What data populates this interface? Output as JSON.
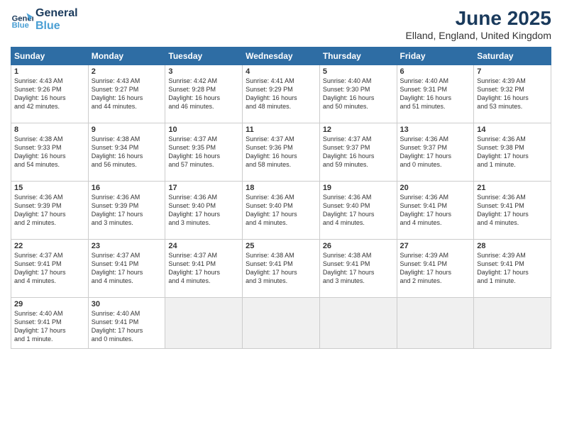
{
  "header": {
    "logo_line1": "General",
    "logo_line2": "Blue",
    "month_year": "June 2025",
    "location": "Elland, England, United Kingdom"
  },
  "days_of_week": [
    "Sunday",
    "Monday",
    "Tuesday",
    "Wednesday",
    "Thursday",
    "Friday",
    "Saturday"
  ],
  "weeks": [
    [
      {
        "day": 1,
        "lines": [
          "Sunrise: 4:43 AM",
          "Sunset: 9:26 PM",
          "Daylight: 16 hours",
          "and 42 minutes."
        ]
      },
      {
        "day": 2,
        "lines": [
          "Sunrise: 4:43 AM",
          "Sunset: 9:27 PM",
          "Daylight: 16 hours",
          "and 44 minutes."
        ]
      },
      {
        "day": 3,
        "lines": [
          "Sunrise: 4:42 AM",
          "Sunset: 9:28 PM",
          "Daylight: 16 hours",
          "and 46 minutes."
        ]
      },
      {
        "day": 4,
        "lines": [
          "Sunrise: 4:41 AM",
          "Sunset: 9:29 PM",
          "Daylight: 16 hours",
          "and 48 minutes."
        ]
      },
      {
        "day": 5,
        "lines": [
          "Sunrise: 4:40 AM",
          "Sunset: 9:30 PM",
          "Daylight: 16 hours",
          "and 50 minutes."
        ]
      },
      {
        "day": 6,
        "lines": [
          "Sunrise: 4:40 AM",
          "Sunset: 9:31 PM",
          "Daylight: 16 hours",
          "and 51 minutes."
        ]
      },
      {
        "day": 7,
        "lines": [
          "Sunrise: 4:39 AM",
          "Sunset: 9:32 PM",
          "Daylight: 16 hours",
          "and 53 minutes."
        ]
      }
    ],
    [
      {
        "day": 8,
        "lines": [
          "Sunrise: 4:38 AM",
          "Sunset: 9:33 PM",
          "Daylight: 16 hours",
          "and 54 minutes."
        ]
      },
      {
        "day": 9,
        "lines": [
          "Sunrise: 4:38 AM",
          "Sunset: 9:34 PM",
          "Daylight: 16 hours",
          "and 56 minutes."
        ]
      },
      {
        "day": 10,
        "lines": [
          "Sunrise: 4:37 AM",
          "Sunset: 9:35 PM",
          "Daylight: 16 hours",
          "and 57 minutes."
        ]
      },
      {
        "day": 11,
        "lines": [
          "Sunrise: 4:37 AM",
          "Sunset: 9:36 PM",
          "Daylight: 16 hours",
          "and 58 minutes."
        ]
      },
      {
        "day": 12,
        "lines": [
          "Sunrise: 4:37 AM",
          "Sunset: 9:37 PM",
          "Daylight: 16 hours",
          "and 59 minutes."
        ]
      },
      {
        "day": 13,
        "lines": [
          "Sunrise: 4:36 AM",
          "Sunset: 9:37 PM",
          "Daylight: 17 hours",
          "and 0 minutes."
        ]
      },
      {
        "day": 14,
        "lines": [
          "Sunrise: 4:36 AM",
          "Sunset: 9:38 PM",
          "Daylight: 17 hours",
          "and 1 minute."
        ]
      }
    ],
    [
      {
        "day": 15,
        "lines": [
          "Sunrise: 4:36 AM",
          "Sunset: 9:39 PM",
          "Daylight: 17 hours",
          "and 2 minutes."
        ]
      },
      {
        "day": 16,
        "lines": [
          "Sunrise: 4:36 AM",
          "Sunset: 9:39 PM",
          "Daylight: 17 hours",
          "and 3 minutes."
        ]
      },
      {
        "day": 17,
        "lines": [
          "Sunrise: 4:36 AM",
          "Sunset: 9:40 PM",
          "Daylight: 17 hours",
          "and 3 minutes."
        ]
      },
      {
        "day": 18,
        "lines": [
          "Sunrise: 4:36 AM",
          "Sunset: 9:40 PM",
          "Daylight: 17 hours",
          "and 4 minutes."
        ]
      },
      {
        "day": 19,
        "lines": [
          "Sunrise: 4:36 AM",
          "Sunset: 9:40 PM",
          "Daylight: 17 hours",
          "and 4 minutes."
        ]
      },
      {
        "day": 20,
        "lines": [
          "Sunrise: 4:36 AM",
          "Sunset: 9:41 PM",
          "Daylight: 17 hours",
          "and 4 minutes."
        ]
      },
      {
        "day": 21,
        "lines": [
          "Sunrise: 4:36 AM",
          "Sunset: 9:41 PM",
          "Daylight: 17 hours",
          "and 4 minutes."
        ]
      }
    ],
    [
      {
        "day": 22,
        "lines": [
          "Sunrise: 4:37 AM",
          "Sunset: 9:41 PM",
          "Daylight: 17 hours",
          "and 4 minutes."
        ]
      },
      {
        "day": 23,
        "lines": [
          "Sunrise: 4:37 AM",
          "Sunset: 9:41 PM",
          "Daylight: 17 hours",
          "and 4 minutes."
        ]
      },
      {
        "day": 24,
        "lines": [
          "Sunrise: 4:37 AM",
          "Sunset: 9:41 PM",
          "Daylight: 17 hours",
          "and 4 minutes."
        ]
      },
      {
        "day": 25,
        "lines": [
          "Sunrise: 4:38 AM",
          "Sunset: 9:41 PM",
          "Daylight: 17 hours",
          "and 3 minutes."
        ]
      },
      {
        "day": 26,
        "lines": [
          "Sunrise: 4:38 AM",
          "Sunset: 9:41 PM",
          "Daylight: 17 hours",
          "and 3 minutes."
        ]
      },
      {
        "day": 27,
        "lines": [
          "Sunrise: 4:39 AM",
          "Sunset: 9:41 PM",
          "Daylight: 17 hours",
          "and 2 minutes."
        ]
      },
      {
        "day": 28,
        "lines": [
          "Sunrise: 4:39 AM",
          "Sunset: 9:41 PM",
          "Daylight: 17 hours",
          "and 1 minute."
        ]
      }
    ],
    [
      {
        "day": 29,
        "lines": [
          "Sunrise: 4:40 AM",
          "Sunset: 9:41 PM",
          "Daylight: 17 hours",
          "and 1 minute."
        ]
      },
      {
        "day": 30,
        "lines": [
          "Sunrise: 4:40 AM",
          "Sunset: 9:41 PM",
          "Daylight: 17 hours",
          "and 0 minutes."
        ]
      },
      null,
      null,
      null,
      null,
      null
    ]
  ]
}
